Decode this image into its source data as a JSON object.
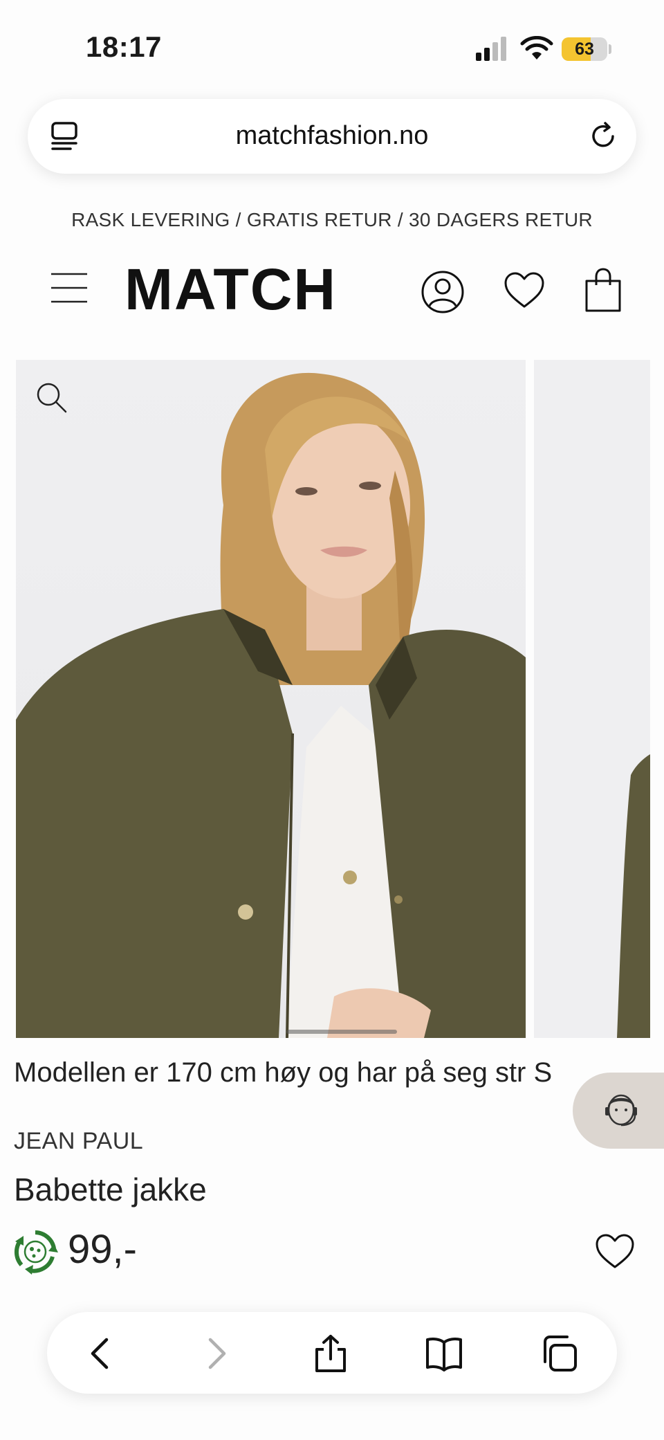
{
  "status_bar": {
    "time": "18:17",
    "battery": "63",
    "battery_level": 0.63
  },
  "browser": {
    "url": "matchfashion.no"
  },
  "promo": {
    "text": "RASK LEVERING / GRATIS RETUR / 30 DAGERS RETUR"
  },
  "header": {
    "logo": "MATCH"
  },
  "product": {
    "model_info": "Modellen er 170 cm høy og har på seg str S",
    "brand": "JEAN PAUL",
    "title": "Babette jakke",
    "price": "99,-"
  },
  "icons": {
    "tabs": "tab-overview-icon",
    "reload": "reload-icon",
    "menu": "hamburger-menu-icon",
    "account": "user-icon",
    "wishlist": "heart-icon",
    "bag": "shopping-bag-icon",
    "zoom": "magnifier-icon",
    "chat": "customer-service-icon",
    "eco": "recycle-icon",
    "back": "chevron-left-icon",
    "forward": "chevron-right-icon",
    "share": "share-icon",
    "bookmarks": "book-icon",
    "tab_switcher": "tabs-icon"
  },
  "colors": {
    "jacket": "#5e5a3c",
    "eco_green": "#2e7d32",
    "battery_yellow": "#f4c430",
    "chat_bg": "#dcd6d0"
  }
}
